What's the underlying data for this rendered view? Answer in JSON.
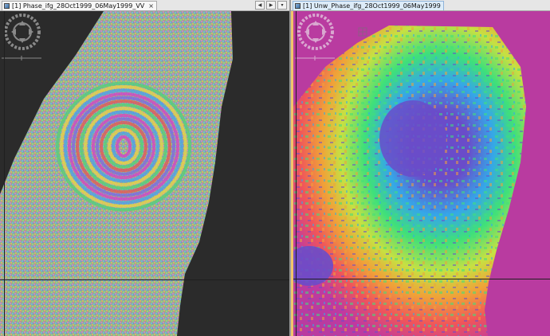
{
  "left_view": {
    "tab_title": "[1] Phase_ifg_28Oct1999_06May1999_VV",
    "tab_close": "×",
    "nav_arrows": {
      "prev": "◀",
      "next": "▶",
      "menu": "▾"
    },
    "icons": [
      "navigation-wheel-icon",
      "scale-bar-icon"
    ],
    "background_color": "#2b2b2b"
  },
  "right_view": {
    "tab_title": "[1] Unw_Phase_ifg_28Oct1999_06May1999",
    "icons": [
      "navigation-wheel-icon",
      "grid-icon",
      "scale-bar-icon"
    ],
    "background_color": "#b93ba0",
    "highlight_color": "#f2c46a"
  }
}
